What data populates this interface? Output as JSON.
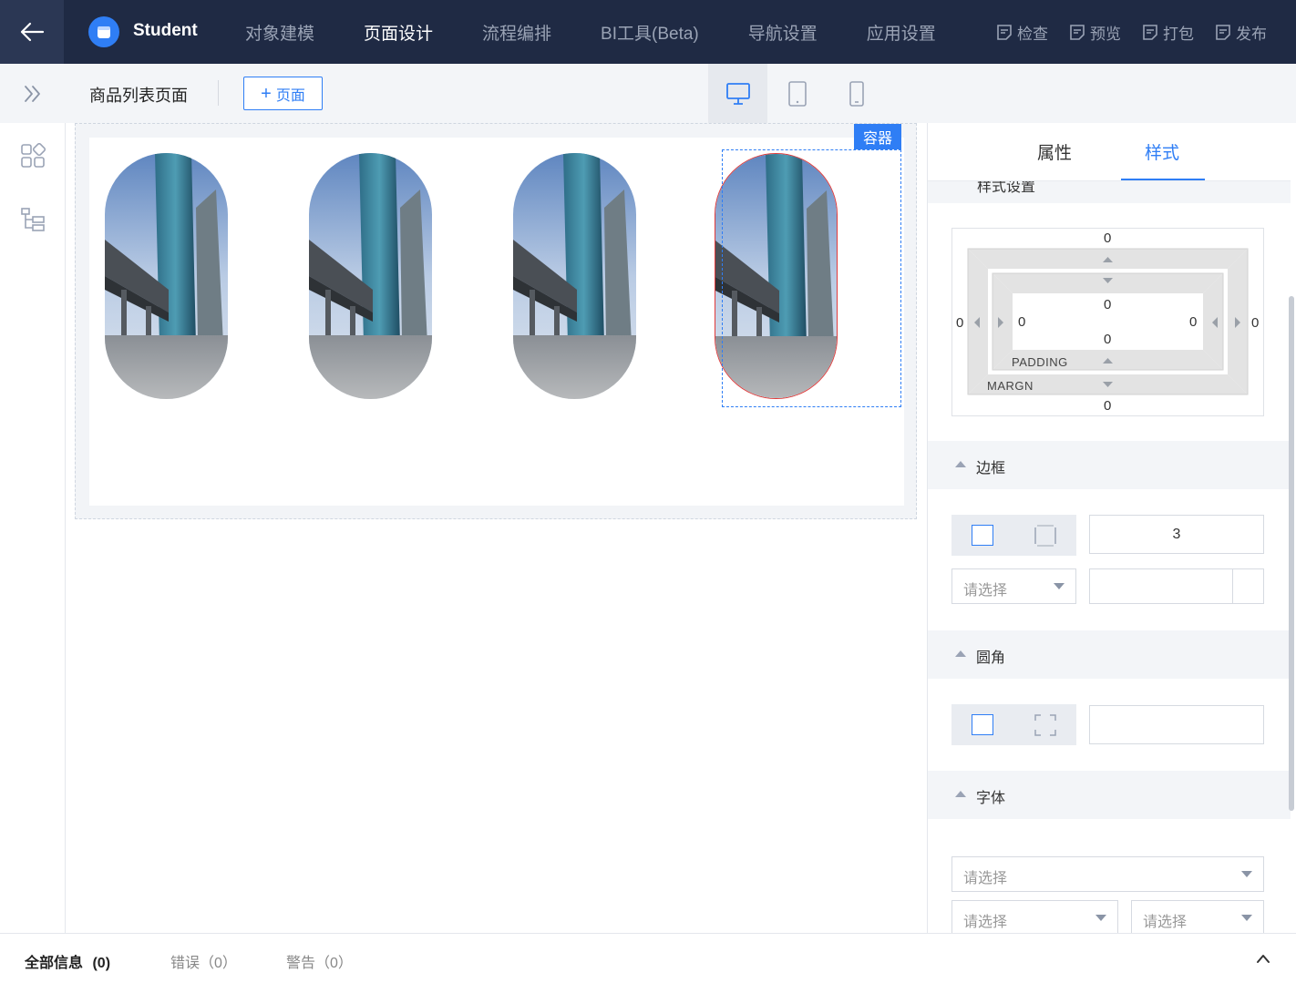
{
  "header": {
    "app_name": "Student",
    "nav": [
      {
        "label": "对象建模",
        "active": false
      },
      {
        "label": "页面设计",
        "active": true
      },
      {
        "label": "流程编排",
        "active": false
      },
      {
        "label": "BI工具(Beta)",
        "active": false
      },
      {
        "label": "导航设置",
        "active": false
      },
      {
        "label": "应用设置",
        "active": false
      }
    ],
    "actions": [
      {
        "label": "检查"
      },
      {
        "label": "预览"
      },
      {
        "label": "打包"
      },
      {
        "label": "发布"
      }
    ]
  },
  "toolbar": {
    "page_title": "商品列表页面",
    "add_page_label": "页面",
    "devices": [
      {
        "name": "desktop",
        "active": true
      },
      {
        "name": "tablet",
        "active": false
      },
      {
        "name": "phone",
        "active": false
      }
    ]
  },
  "canvas": {
    "container_tag": "容器",
    "images": [
      {
        "selected": false
      },
      {
        "selected": false
      },
      {
        "selected": false
      },
      {
        "selected": true
      }
    ]
  },
  "panel": {
    "tabs": [
      {
        "label": "属性",
        "active": false
      },
      {
        "label": "样式",
        "active": true
      }
    ],
    "hidden_section_title": "样式设置",
    "box_model": {
      "margin_top": "0",
      "margin_bottom": "0",
      "margin_left": "0",
      "margin_right": "0",
      "padding_top": "0",
      "padding_bottom": "0",
      "padding_left": "0",
      "padding_right": "0",
      "padding_label": "PADDING",
      "margin_label": "MARGN"
    },
    "border": {
      "title": "边框",
      "width_value": "3",
      "style_placeholder": "请选择"
    },
    "radius": {
      "title": "圆角",
      "value": ""
    },
    "font": {
      "title": "字体",
      "family_placeholder": "请选择",
      "size_placeholder": "请选择",
      "weight_placeholder": "请选择"
    }
  },
  "bottom": {
    "tabs": [
      {
        "label": "全部信息",
        "count": "(0)",
        "active": true
      },
      {
        "label": "错误",
        "count": "（0）",
        "active": false
      },
      {
        "label": "警告",
        "count": "（0）",
        "active": false
      }
    ]
  },
  "colors": {
    "accent": "#2f7ef5",
    "topbar": "#1f2a44",
    "selected_outline": "#e03a3a"
  }
}
